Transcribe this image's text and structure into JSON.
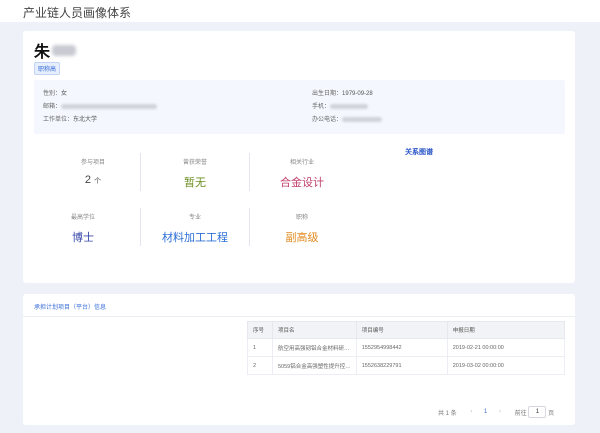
{
  "app": {
    "title": "产业链人员画像体系"
  },
  "profile": {
    "name": "朱",
    "tag": "职称高",
    "gender_label": "性别：",
    "gender": "女",
    "birth_label": "出生日期：",
    "birth": "1979-09-28",
    "email_label": "邮箱：",
    "phone_label": "手机：",
    "employer_label": "工作单位：",
    "employer": "东北大学",
    "office_label": "办公电话："
  },
  "stats": [
    {
      "label": "参与项目",
      "value": "2",
      "unit": "个",
      "color": "#444444"
    },
    {
      "label": "曾获荣誉",
      "value": "暂无",
      "color": "#6b8e23"
    },
    {
      "label": "相关行业",
      "value": "合金设计",
      "color": "#c0406a"
    },
    {
      "label": "最高学位",
      "value": "博士",
      "color": "#3949ab"
    },
    {
      "label": "专业",
      "value": "材料加工工程",
      "color": "#2d6fd6"
    },
    {
      "label": "职称",
      "value": "副高级",
      "color": "#e08a1e"
    }
  ],
  "relation_graph": {
    "label": "关系图谱"
  },
  "projects": {
    "section_title": "承担计划项目（平台）信息",
    "headers": [
      "序号",
      "项目名",
      "项目编号",
      "申报日期"
    ],
    "rows": [
      [
        "1",
        "航空用高强韧铝合金材料研…",
        "1552954998442",
        "2019-02-21 00:00:00"
      ],
      [
        "2",
        "5059铝合金高强塑性提升控…",
        "1552638229791",
        "2019-03-02 00:00:00"
      ]
    ]
  },
  "pager": {
    "total": "共 1 条",
    "prev": "‹",
    "current": "1",
    "next": "›",
    "goto_label": "前往",
    "goto_value": "1",
    "page_label": "页"
  }
}
